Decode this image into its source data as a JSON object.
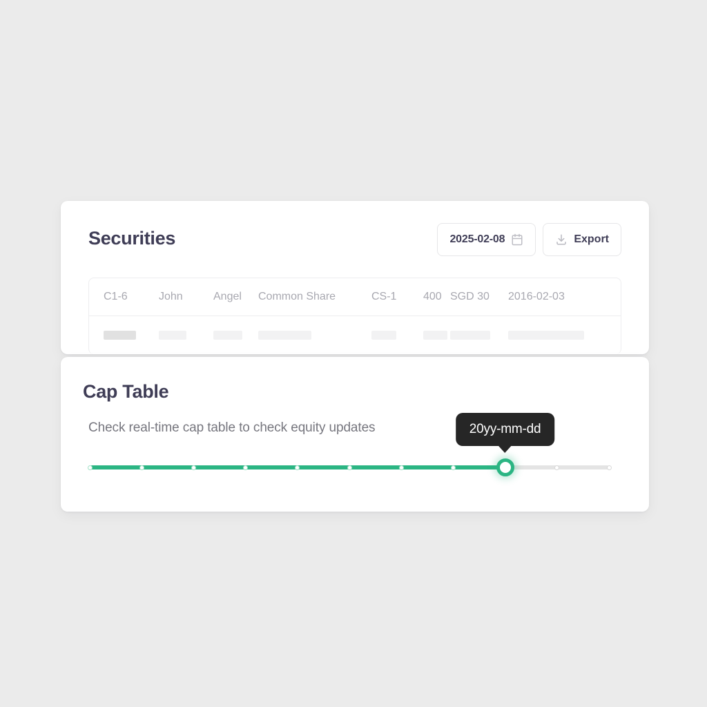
{
  "securities": {
    "title": "Securities",
    "date_button": {
      "value": "2025-02-08",
      "icon": "calendar-icon"
    },
    "export_button": {
      "label": "Export",
      "icon": "download-icon"
    },
    "table": {
      "header_row": [
        "C1-6",
        "John",
        "Angel",
        "Common Share",
        "CS-1",
        "400",
        "SGD 30",
        "2016-02-03"
      ],
      "skeleton_row_cells": 8
    }
  },
  "cap_table": {
    "title": "Cap Table",
    "subtitle": "Check real-time cap table to check equity updates",
    "tooltip": "20yy-mm-dd",
    "slider": {
      "ticks": 11,
      "value_index": 8,
      "min_index": 0,
      "max_index": 10,
      "fill_color": "#2bb583",
      "track_color": "#e4e4e4"
    }
  },
  "colors": {
    "background": "#ebebeb",
    "card": "#ffffff",
    "heading": "#3f3d56",
    "muted_text": "#a8a8b0",
    "subtitle_text": "#76767e",
    "accent": "#2bb583",
    "tooltip_bg": "#262626"
  }
}
